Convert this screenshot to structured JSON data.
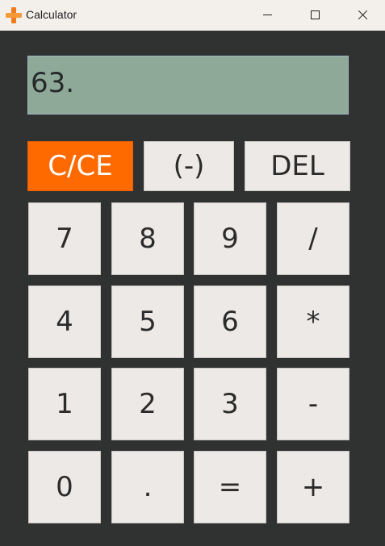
{
  "window": {
    "title": "Calculator",
    "app_icon": "orange-plus-icon"
  },
  "display": {
    "value": "63."
  },
  "colors": {
    "accent": "#ff6a00",
    "display_bg": "#8fa999",
    "body_bg": "#2f3231",
    "key_bg": "#ede9e6"
  },
  "keys": {
    "clear": "C/CE",
    "negate": "(-)",
    "delete": "DEL",
    "seven": "7",
    "eight": "8",
    "nine": "9",
    "divide": "/",
    "four": "4",
    "five": "5",
    "six": "6",
    "multiply": "*",
    "one": "1",
    "two": "2",
    "three": "3",
    "subtract": "-",
    "zero": "0",
    "decimal": ".",
    "equals": "=",
    "add": "+"
  }
}
